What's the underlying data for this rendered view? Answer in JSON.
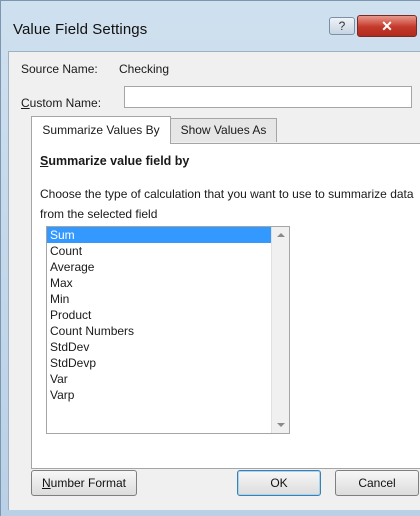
{
  "window": {
    "title": "Value Field Settings",
    "help_glyph": "?",
    "close_glyph": "✕"
  },
  "source": {
    "label": "Source Name:",
    "value": "Checking"
  },
  "custom_name": {
    "label_first": "C",
    "label_rest": "ustom Name:",
    "value": ""
  },
  "tabs": [
    {
      "label": "Summarize Values By",
      "active": true
    },
    {
      "label": "Show Values As",
      "active": false
    }
  ],
  "section": {
    "title_first": "S",
    "title_rest": "ummarize value field by",
    "description": "Choose the type of calculation that you want to use to summarize data from the selected field"
  },
  "list": {
    "items": [
      "Sum",
      "Count",
      "Average",
      "Max",
      "Min",
      "Product",
      "Count Numbers",
      "StdDev",
      "StdDevp",
      "Var",
      "Varp"
    ],
    "selected": "Sum"
  },
  "buttons": {
    "number_format_first": "N",
    "number_format_rest": "umber Format",
    "ok": "OK",
    "cancel": "Cancel"
  },
  "colors": {
    "selection": "#3399ff",
    "close": "#c4392a"
  }
}
